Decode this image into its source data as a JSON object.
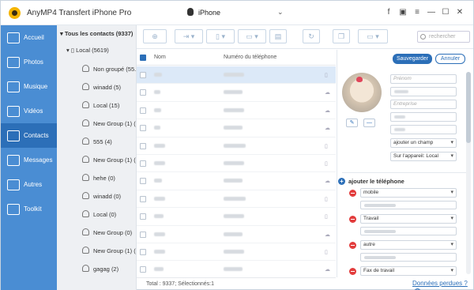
{
  "app": {
    "title": "AnyMP4 Transfert iPhone Pro",
    "device": "iPhone"
  },
  "window_buttons": [
    "f",
    "▣",
    "≡",
    "—",
    "☐",
    "✕"
  ],
  "sidebar": {
    "items": [
      {
        "label": "Accueil",
        "icon": "home-icon"
      },
      {
        "label": "Photos",
        "icon": "photo-icon"
      },
      {
        "label": "Musique",
        "icon": "music-icon"
      },
      {
        "label": "Vidéos",
        "icon": "video-icon"
      },
      {
        "label": "Contacts",
        "icon": "contacts-icon",
        "active": true
      },
      {
        "label": "Messages",
        "icon": "messages-icon"
      },
      {
        "label": "Autres",
        "icon": "more-icon"
      },
      {
        "label": "Toolkit",
        "icon": "toolkit-icon"
      }
    ]
  },
  "tree": {
    "root": "Tous les contacts  (9337)",
    "local": "Local  (5619)",
    "groups": [
      "Non groupé  (55...",
      "winadd  (5)",
      "Local  (15)",
      "New Group (1)  (1",
      "555  (4)",
      "New Group (1)  (0",
      "hehe  (0)",
      "winadd  (0)",
      "Local  (0)",
      "New Group  (0)",
      "New Group (1)  (0",
      "gagag  (2)"
    ]
  },
  "search": {
    "placeholder": "rechercher"
  },
  "list": {
    "col_name": "Nom",
    "col_phone": "Numéro du téléphone",
    "row_icons": [
      "▯",
      "☁",
      "☁",
      "☁",
      "▯",
      "▯",
      "☁",
      "▯",
      "▯",
      "☁",
      "▯",
      "☁"
    ],
    "footer": "Total : 9337; Sélectionnés:1"
  },
  "detail": {
    "save": "Sauvegarder",
    "cancel": "Annuler",
    "placeholders": {
      "first": "Prénom",
      "company": "Entreprise"
    },
    "add_field": "ajouter un champ",
    "on_device": "Sur l'appareil: Local",
    "add_phone": "ajouter le téléphone",
    "phone_types": [
      "mobile",
      "Travail",
      "autre",
      "Fax de travail"
    ]
  },
  "lost_data_link": "Données perdues ?",
  "colors": {
    "sidebar": "#4a8dd3",
    "sidebar_active": "#2c6fb8",
    "accent": "#2c6fb8",
    "danger": "#e23c3c"
  }
}
